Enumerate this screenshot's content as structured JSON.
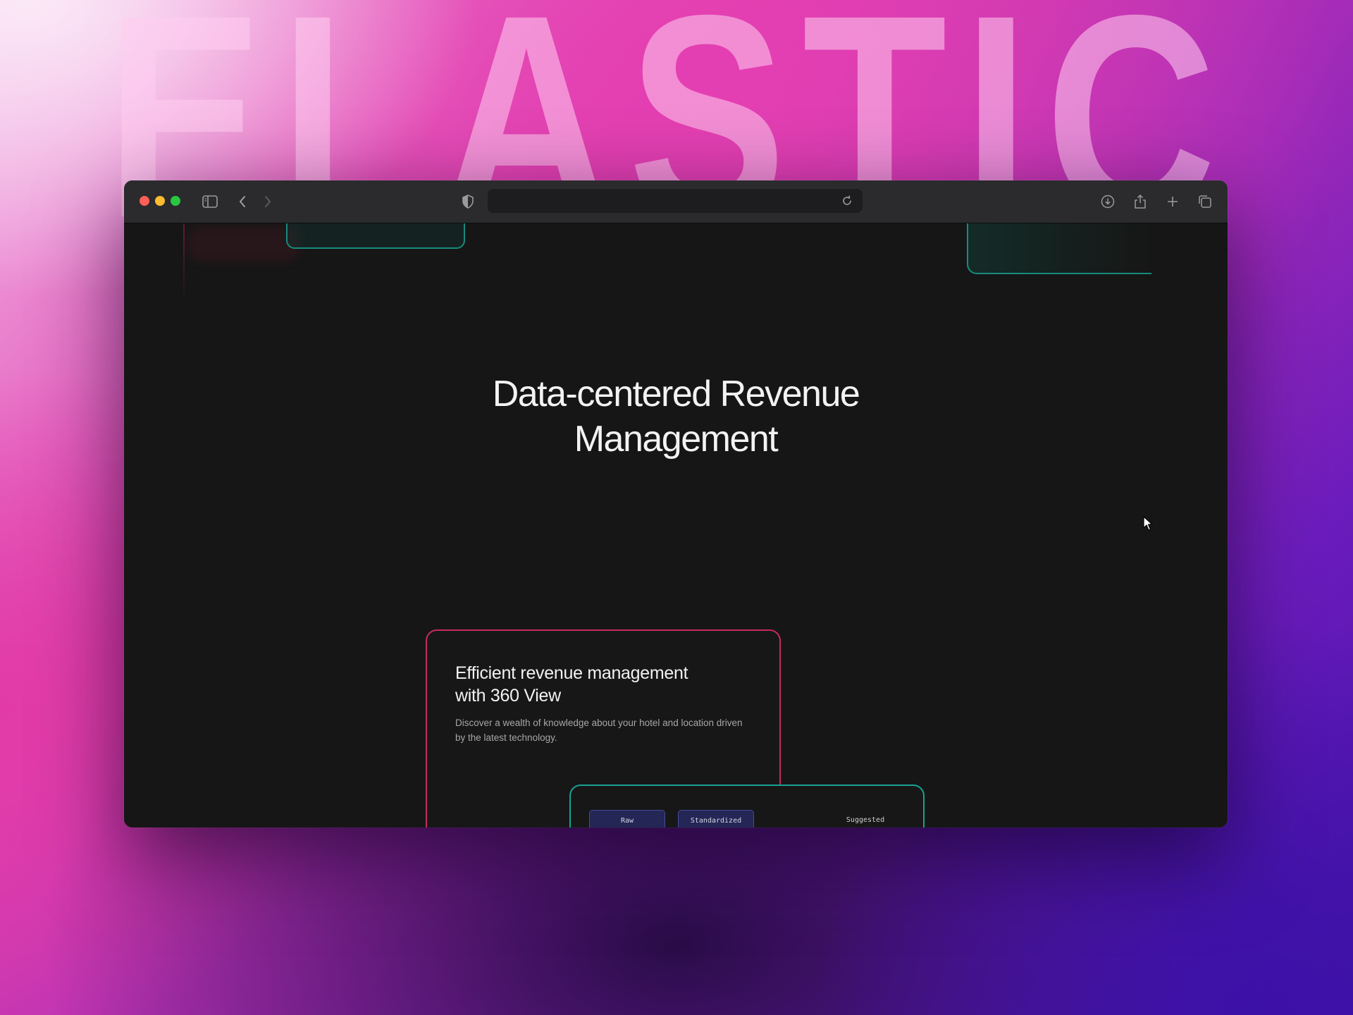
{
  "background": {
    "word": "ELASTIC",
    "colors": {
      "pink": "#e23ba8",
      "purple": "#6c1cbc",
      "deep_purple": "#3c11a8"
    }
  },
  "browser": {
    "toolbar_icons": [
      "sidebar-icon",
      "back-chevron-icon",
      "forward-chevron-icon",
      "shield-icon",
      "reload-icon",
      "download-icon",
      "share-icon",
      "new-tab-plus-icon",
      "tab-overview-icon"
    ],
    "address": ""
  },
  "hero": {
    "title_line1": "Data-centered Revenue",
    "title_line2": "Management"
  },
  "feature_card": {
    "title_line1": "Efficient revenue management",
    "title_line2": "with 360 View",
    "description": "Discover a wealth of knowledge about your hotel and location driven by the latest technology.",
    "accent_color": "#c52a5e"
  },
  "data_view_card": {
    "accent_color": "#17a293",
    "options": [
      "Raw",
      "Standardized"
    ],
    "suggested_label": "Suggested"
  }
}
